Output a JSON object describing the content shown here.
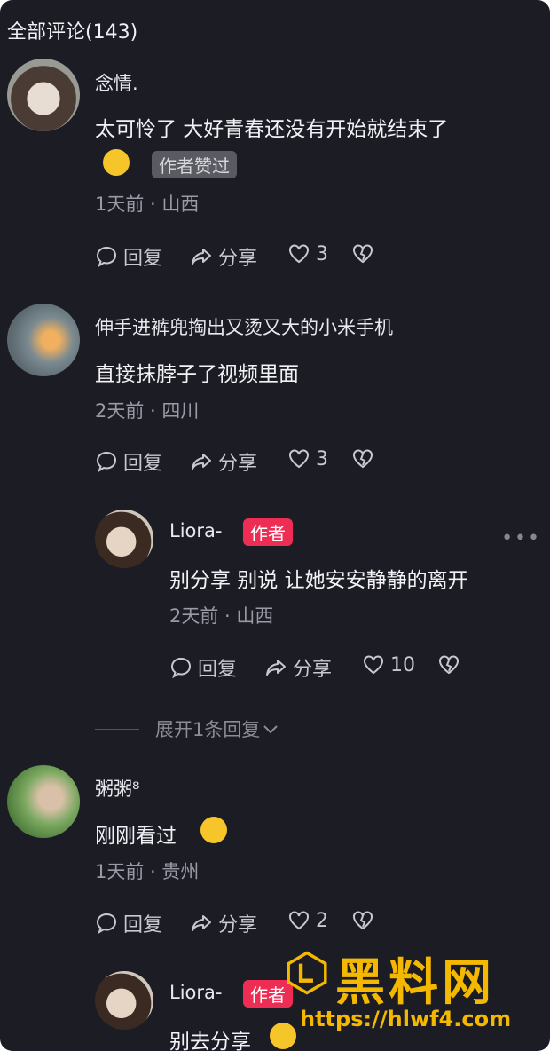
{
  "header": {
    "title": "全部评论(143)"
  },
  "actions": {
    "reply": "回复",
    "share": "分享"
  },
  "comments": [
    {
      "name": "念情.",
      "text": "太可怜了 大好青春还没有开始就结束了",
      "badge": "作者赞过",
      "meta": "1天前 · 山西",
      "likes": "3"
    },
    {
      "name": "伸手进裤兜掏出又烫又大的小米手机",
      "text": "直接抹脖子了视频里面",
      "meta": "2天前 · 四川",
      "likes": "3"
    },
    {
      "name": "Liora-",
      "badge": "作者",
      "text": "别分享 别说 让她安安静静的离开",
      "meta": "2天前 · 山西",
      "likes": "10"
    },
    {
      "name": "粥粥⁸",
      "text": "刚刚看过",
      "meta": "1天前 · 贵州",
      "likes": "2"
    },
    {
      "name": "Liora-",
      "badge": "作者",
      "text": "别去分享"
    }
  ],
  "expand": {
    "label": "展开1条回复"
  },
  "watermark": {
    "brand": "黑料网",
    "url": "https://hlwf4.com"
  },
  "colors": {
    "background": "#1c1c24",
    "author_badge": "#ee2d55",
    "watermark": "#f5b800"
  }
}
